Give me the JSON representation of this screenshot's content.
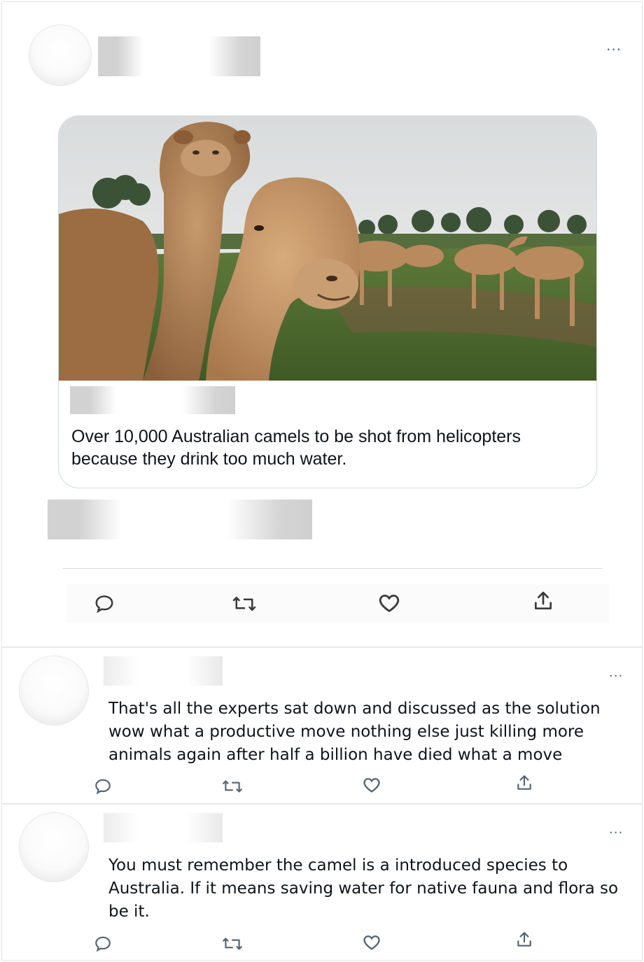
{
  "main_tweet": {
    "more_label": "···",
    "link_card": {
      "title": "Over 10,000 Australian camels to be shot from helicopters because they drink too much water."
    },
    "actions": {
      "reply_icon": "reply-icon",
      "retweet_icon": "retweet-icon",
      "like_icon": "heart-icon",
      "share_icon": "share-icon"
    }
  },
  "replies": [
    {
      "more_label": "···",
      "text": "That's all the experts sat down and discussed as the solution wow what a productive move nothing else just killing more animals again after half a billion have died what a move"
    },
    {
      "more_label": "···",
      "text": "You must remember the camel is a introduced species to Australia. If it means saving water for native fauna and flora so be it."
    }
  ],
  "colors": {
    "text": "#0f1419",
    "icon": "#536471",
    "border": "#cfd9de"
  }
}
